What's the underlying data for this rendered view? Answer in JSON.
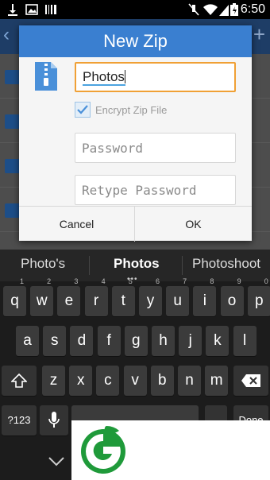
{
  "status_bar": {
    "time": "6:50"
  },
  "dialog": {
    "title": "New Zip",
    "filename_value": "Photos",
    "encrypt_label": "Encrypt Zip File",
    "encrypt_checked": true,
    "password_placeholder": "Password",
    "retype_placeholder": "Retype Password",
    "cancel_label": "Cancel",
    "ok_label": "OK"
  },
  "suggestions": {
    "left": "Photo's",
    "center": "Photos",
    "right": "Photoshoot"
  },
  "keyboard": {
    "row1": [
      {
        "k": "q",
        "h": "1"
      },
      {
        "k": "w",
        "h": "2"
      },
      {
        "k": "e",
        "h": "3"
      },
      {
        "k": "r",
        "h": "4"
      },
      {
        "k": "t",
        "h": "5"
      },
      {
        "k": "y",
        "h": "6"
      },
      {
        "k": "u",
        "h": "7"
      },
      {
        "k": "i",
        "h": "8"
      },
      {
        "k": "o",
        "h": "9"
      },
      {
        "k": "p",
        "h": "0"
      }
    ],
    "row2": [
      "a",
      "s",
      "d",
      "f",
      "g",
      "h",
      "j",
      "k",
      "l"
    ],
    "row3": [
      "z",
      "x",
      "c",
      "v",
      "b",
      "n",
      "m"
    ],
    "symbols_label": "?123",
    "done_label": "Done"
  },
  "colors": {
    "accent": "#3a7fd0",
    "focus": "#f0a035"
  }
}
